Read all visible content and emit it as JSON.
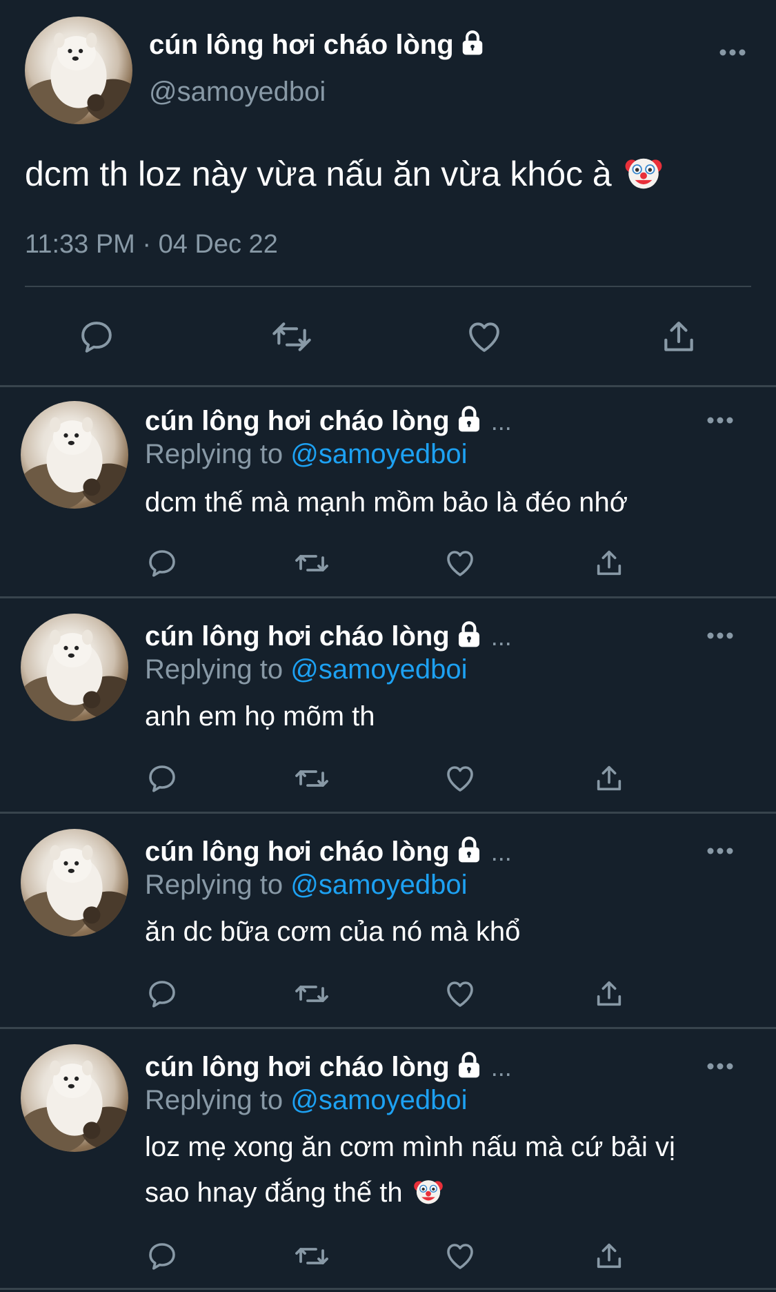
{
  "main_tweet": {
    "display_name": "cún lông hơi cháo lòng",
    "handle": "@samoyedboi",
    "text": "dcm th loz này vừa nấu ăn vừa khóc à",
    "timestamp": "11:33 PM · 04 Dec 22",
    "emoji": "clown-face",
    "actions": [
      "reply-icon",
      "retweet-icon",
      "like-icon",
      "share-icon"
    ]
  },
  "replies": [
    {
      "display_name": "cún lông hơi cháo lòng",
      "ellipsis": "...",
      "replying_prefix": "Replying to",
      "replying_to": "@samoyedboi",
      "text": "dcm thế mà mạnh mồm bảo là đéo nhớ"
    },
    {
      "display_name": "cún lông hơi cháo lòng",
      "ellipsis": "...",
      "replying_prefix": "Replying to",
      "replying_to": "@samoyedboi",
      "text": "anh em họ mõm th"
    },
    {
      "display_name": "cún lông hơi cháo lòng",
      "ellipsis": "...",
      "replying_prefix": "Replying to",
      "replying_to": "@samoyedboi",
      "text": "ăn dc bữa cơm của nó mà khổ"
    },
    {
      "display_name": "cún lông hơi cháo lòng",
      "ellipsis": "...",
      "replying_prefix": "Replying to",
      "replying_to": "@samoyedboi",
      "text_line1": "loz mẹ xong ăn cơm mình nấu mà cứ bải vị",
      "text_line2": "sao hnay đắng thế th"
    }
  ],
  "colors": {
    "background": "#15202b",
    "divider": "#38444d",
    "secondary_text": "#8899a6",
    "mention": "#1da1f2"
  }
}
